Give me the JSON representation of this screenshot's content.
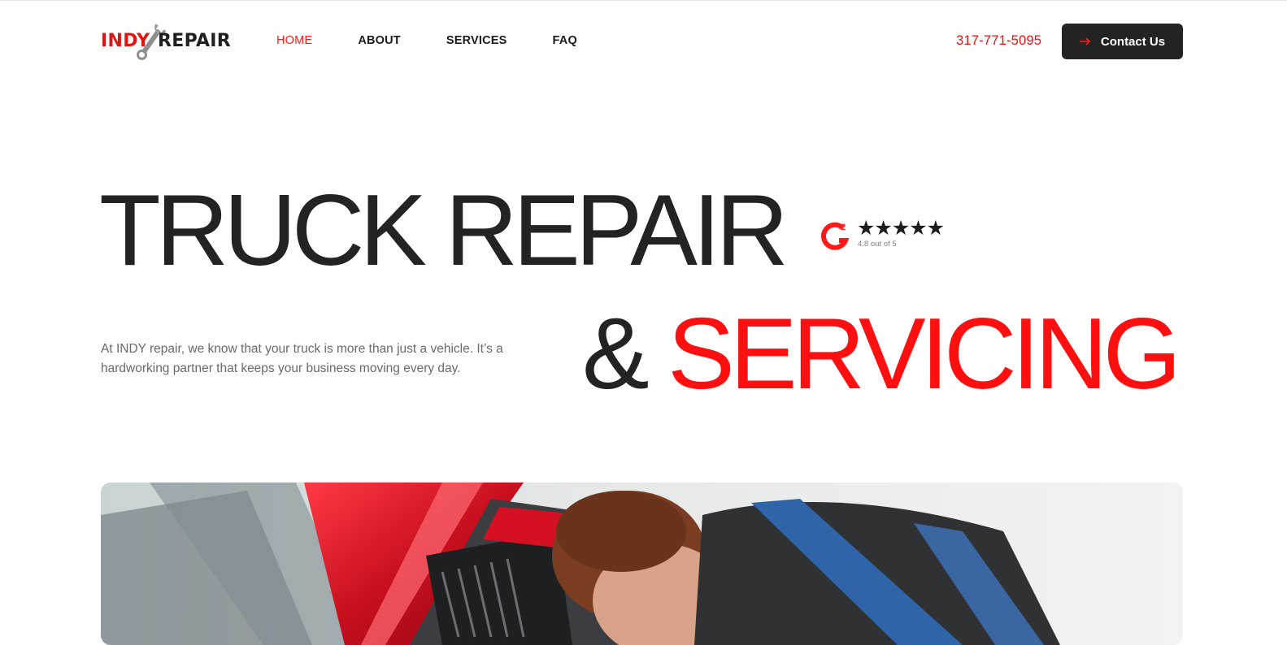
{
  "brand": {
    "logo_indy": "INDY",
    "logo_repair": "REPAIR"
  },
  "nav": {
    "items": [
      {
        "label": "HOME",
        "active": true
      },
      {
        "label": "ABOUT",
        "active": false
      },
      {
        "label": "SERVICES",
        "active": false
      },
      {
        "label": "FAQ",
        "active": false
      }
    ]
  },
  "header": {
    "phone": "317-771-5095",
    "contact_label": "Contact Us"
  },
  "hero": {
    "title_line1": "TRUCK REPAIR",
    "title_amp": "&",
    "title_highlight": "SERVICING",
    "description": "At INDY repair, we know that your truck is more than just a vehicle. It’s a hardworking partner that keeps your business moving every day."
  },
  "rating": {
    "badge": "G2",
    "stars": "★★★★★",
    "stars_value": 5,
    "text": "4.8 out of 5"
  },
  "colors": {
    "accent": "#ff1010",
    "dark": "#232323",
    "muted": "#6a6a6a"
  },
  "icons": [
    "wrench-icon",
    "arrow-right-icon",
    "g2-icon",
    "star-icon"
  ]
}
